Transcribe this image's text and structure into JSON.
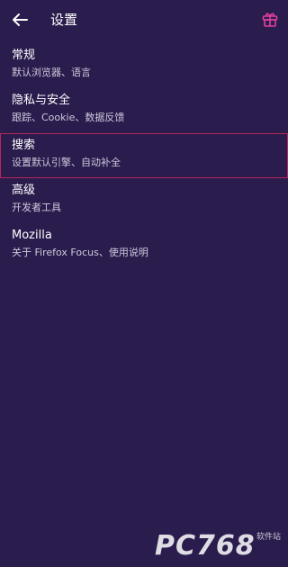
{
  "header": {
    "title": "设置",
    "back_icon": "arrow-left-icon",
    "gift_icon": "gift-icon",
    "gift_color": "#e040a0"
  },
  "settings": {
    "items": [
      {
        "title": "常规",
        "subtitle": "默认浏览器、语言"
      },
      {
        "title": "隐私与安全",
        "subtitle": "跟踪、Cookie、数据反馈"
      },
      {
        "title": "搜索",
        "subtitle": "设置默认引擎、自动补全"
      },
      {
        "title": "高级",
        "subtitle": "开发者工具"
      },
      {
        "title": "Mozilla",
        "subtitle": "关于 Firefox Focus、使用说明"
      }
    ],
    "selected_index": 2,
    "selected_border_color": "#b8255a"
  },
  "watermark": {
    "main": "PC768",
    "sub": "软件站"
  },
  "colors": {
    "background": "#2a1c4d",
    "text_primary": "#ffffff",
    "text_secondary": "#cfc8dc"
  }
}
